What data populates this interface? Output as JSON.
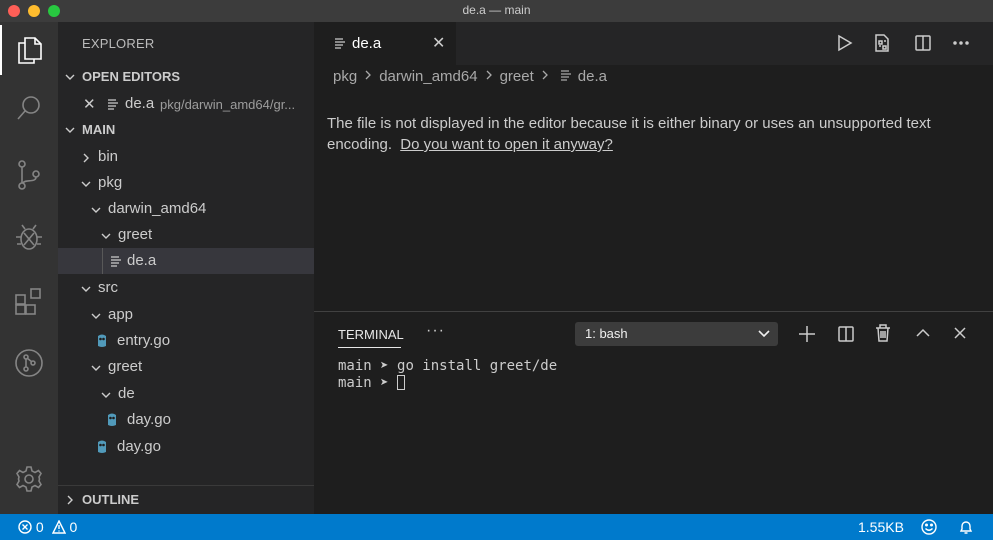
{
  "window": {
    "title": "de.a — main"
  },
  "sidebar": {
    "title": "EXPLORER",
    "open_editors_header": "OPEN EDITORS",
    "open_editor": {
      "name": "de.a",
      "path": "pkg/darwin_amd64/gr..."
    },
    "workspace_header": "MAIN",
    "tree": [
      {
        "label": "bin",
        "type": "folder",
        "expanded": false
      },
      {
        "label": "pkg",
        "type": "folder",
        "expanded": true
      },
      {
        "label": "darwin_amd64",
        "type": "folder",
        "expanded": true
      },
      {
        "label": "greet",
        "type": "folder",
        "expanded": true
      },
      {
        "label": "de.a",
        "type": "file",
        "selected": true
      },
      {
        "label": "src",
        "type": "folder",
        "expanded": true
      },
      {
        "label": "app",
        "type": "folder",
        "expanded": true
      },
      {
        "label": "entry.go",
        "type": "go-file"
      },
      {
        "label": "greet",
        "type": "folder",
        "expanded": true
      },
      {
        "label": "de",
        "type": "folder",
        "expanded": true
      },
      {
        "label": "day.go",
        "type": "go-file"
      },
      {
        "label": "day.go",
        "type": "go-file"
      }
    ],
    "outline_header": "OUTLINE"
  },
  "editor": {
    "tab": {
      "label": "de.a"
    },
    "breadcrumb": [
      "pkg",
      "darwin_amd64",
      "greet",
      "de.a"
    ],
    "message": "The file is not displayed in the editor because it is either binary or uses an unsupported text encoding.",
    "message_link": "Do you want to open it anyway?"
  },
  "panel": {
    "title": "TERMINAL",
    "more": "···",
    "terminal_select": "1: bash",
    "lines": [
      {
        "prompt": "main ➤ ",
        "command": "go install greet/de"
      },
      {
        "prompt": "main ➤ ",
        "command": ""
      }
    ]
  },
  "status": {
    "errors": "0",
    "warnings": "0",
    "file_size": "1.55KB"
  },
  "colors": {
    "accent": "#007acc",
    "activity_bar": "#333333",
    "sidebar": "#252526",
    "editor": "#1e1e1e",
    "go_icon": "#519aba"
  }
}
